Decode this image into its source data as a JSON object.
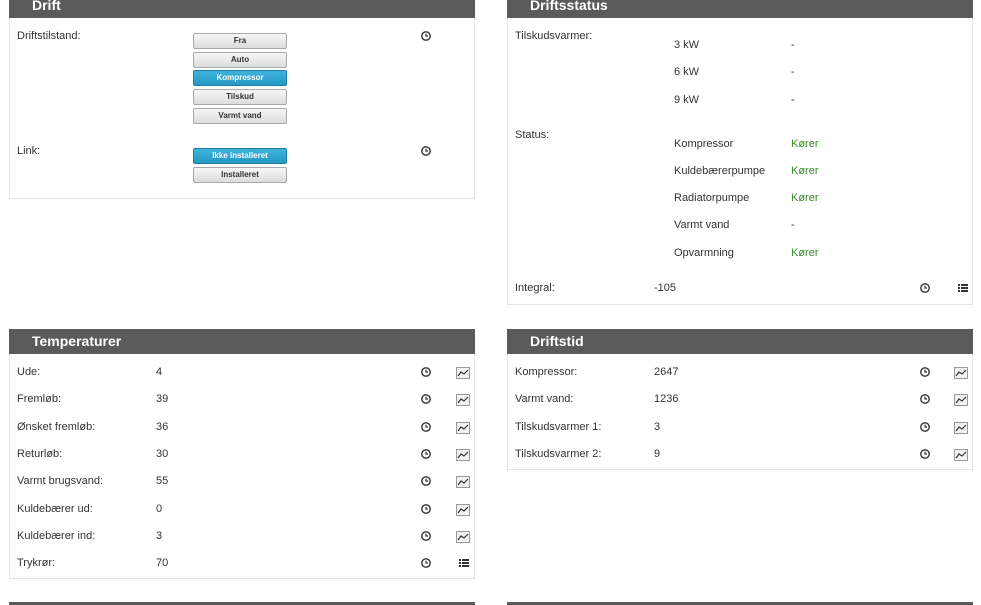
{
  "drift": {
    "title": "Drift",
    "mode_label": "Driftstilstand:",
    "mode_options": [
      "Fra",
      "Auto",
      "Kompressor",
      "Tilskud",
      "Varmt vand"
    ],
    "mode_active": "Kompressor",
    "link_label": "Link:",
    "link_options": [
      "Ikke installeret",
      "Installeret"
    ],
    "link_active": "Ikke installeret"
  },
  "driftsstatus": {
    "title": "Driftsstatus",
    "tilskud_label": "Tilskudsvarmer:",
    "tilskud_rows": [
      {
        "name": "3 kW",
        "value": "-"
      },
      {
        "name": "6 kW",
        "value": "-"
      },
      {
        "name": "9 kW",
        "value": "-"
      }
    ],
    "status_label": "Status:",
    "status_rows": [
      {
        "name": "Kompressor",
        "value": "Kører"
      },
      {
        "name": "Kuldebærerpumpe",
        "value": "Kører"
      },
      {
        "name": "Radiatorpumpe",
        "value": "Kører"
      },
      {
        "name": "Varmt vand",
        "value": "-"
      },
      {
        "name": "Opvarmning",
        "value": "Kører"
      }
    ],
    "integral_label": "Integral:",
    "integral_value": "-105"
  },
  "temperaturer": {
    "title": "Temperaturer",
    "rows": [
      {
        "label": "Ude:",
        "value": "4"
      },
      {
        "label": "Fremløb:",
        "value": "39"
      },
      {
        "label": "Ønsket fremløb:",
        "value": "36"
      },
      {
        "label": "Returløb:",
        "value": "30"
      },
      {
        "label": "Varmt brugsvand:",
        "value": "55"
      },
      {
        "label": "Kuldebærer ud:",
        "value": "0"
      },
      {
        "label": "Kuldebærer ind:",
        "value": "3"
      },
      {
        "label": "Trykrør:",
        "value": "70"
      }
    ]
  },
  "driftstid": {
    "title": "Driftstid",
    "rows": [
      {
        "label": "Kompressor:",
        "value": "2647"
      },
      {
        "label": "Varmt vand:",
        "value": "1236"
      },
      {
        "label": "Tilskudsvarmer 1:",
        "value": "3"
      },
      {
        "label": "Tilskudsvarmer 2:",
        "value": "9"
      }
    ]
  },
  "colors": {
    "header_bg": "#5a5a5a",
    "active_button": "#2aa3d1",
    "running_text": "#3a8a2a"
  },
  "icons": {
    "history": "clock-icon",
    "graph": "chart-icon",
    "list": "list-icon"
  }
}
